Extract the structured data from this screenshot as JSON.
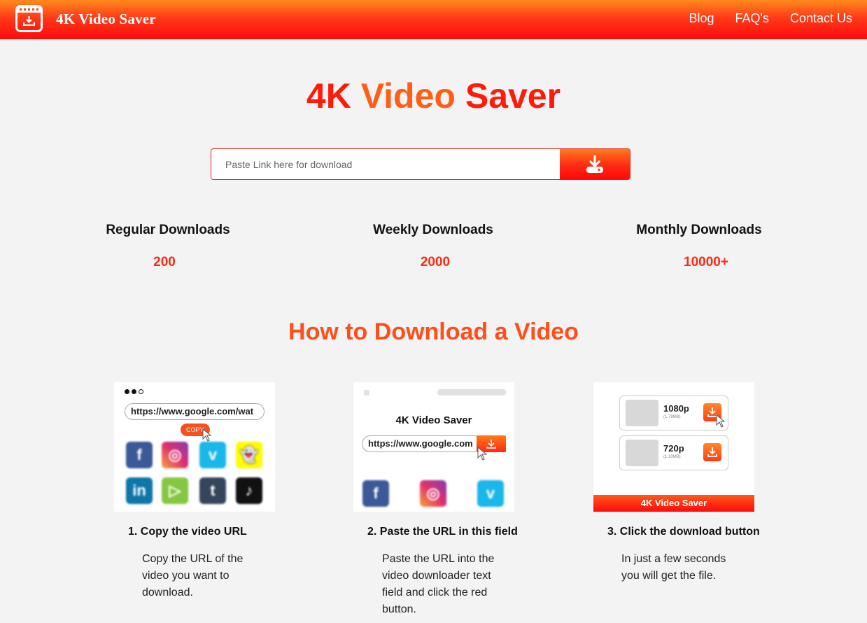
{
  "brand": {
    "name": "4K Video Saver"
  },
  "nav": {
    "links": [
      "Blog",
      "FAQ's",
      "Contact Us"
    ]
  },
  "hero": {
    "title_part1": "4K ",
    "title_part2": "Video",
    "title_part3": " Saver",
    "search_placeholder": "Paste Link here for download"
  },
  "stats": [
    {
      "label": "Regular Downloads",
      "value": "200"
    },
    {
      "label": "Weekly Downloads",
      "value": "2000"
    },
    {
      "label": "Monthly Downloads",
      "value": "10000+"
    }
  ],
  "howto": {
    "title": "How to Download a Video",
    "steps": [
      {
        "title": "1. Copy the video URL",
        "desc": "Copy the URL of the video you want to download."
      },
      {
        "title": "2. Paste the URL in this field",
        "desc": "Paste the URL into the video downloader text field and click the red button."
      },
      {
        "title": "3. Click the download button",
        "desc": "In just a few seconds you will get the file."
      }
    ]
  },
  "illustrations": {
    "card1": {
      "url": "https://www.google.com/wat",
      "copy_label": "COPY"
    },
    "card2": {
      "title": "4K Video Saver",
      "url": "https://www.google.com"
    },
    "card3": {
      "rows": [
        {
          "quality": "1080p",
          "size": "(1.78MB)"
        },
        {
          "quality": "720p",
          "size": "(1.10MB)"
        }
      ],
      "footer": "4K Video Saver"
    }
  },
  "colors": {
    "brand_red": "#ff1a0a",
    "brand_orange": "#ff7a1a",
    "background": "#f3f3f3"
  },
  "icons": [
    "download-icon",
    "facebook-icon",
    "instagram-icon",
    "vimeo-icon",
    "snapchat-icon",
    "linkedin-icon",
    "rumble-icon",
    "tumblr-icon",
    "tiktok-icon"
  ]
}
